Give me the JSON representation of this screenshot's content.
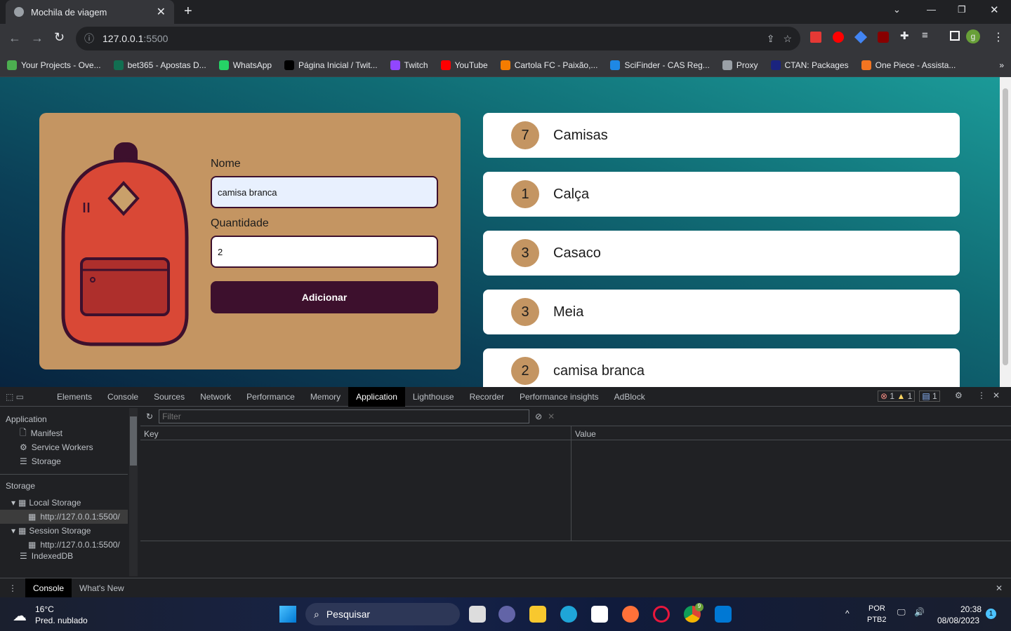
{
  "browser": {
    "tab_title": "Mochila de viagem",
    "url_host": "127.0.0.1",
    "url_port": ":5500",
    "profile_initial": "g",
    "bookmarks": [
      {
        "label": "Your Projects - Ove...",
        "color": "#4caf50"
      },
      {
        "label": "bet365 - Apostas D...",
        "color": "#126e51"
      },
      {
        "label": "WhatsApp",
        "color": "#25d366"
      },
      {
        "label": "Página Inicial / Twit...",
        "color": "#000000"
      },
      {
        "label": "Twitch",
        "color": "#9146ff"
      },
      {
        "label": "YouTube",
        "color": "#ff0000"
      },
      {
        "label": "Cartola FC - Paixão,...",
        "color": "#f57c00"
      },
      {
        "label": "SciFinder - CAS Reg...",
        "color": "#1e88e5"
      },
      {
        "label": "Proxy",
        "color": "#9aa0a6"
      },
      {
        "label": "CTAN: Packages",
        "color": "#1a237e"
      },
      {
        "label": "One Piece - Assista...",
        "color": "#f47521"
      }
    ]
  },
  "form": {
    "name_label": "Nome",
    "name_value": "camisa branca",
    "qty_label": "Quantidade",
    "qty_value": "2",
    "submit_label": "Adicionar"
  },
  "items": [
    {
      "qty": "7",
      "name": "Camisas"
    },
    {
      "qty": "1",
      "name": "Calça"
    },
    {
      "qty": "3",
      "name": "Casaco"
    },
    {
      "qty": "3",
      "name": "Meia"
    },
    {
      "qty": "2",
      "name": "camisa branca"
    }
  ],
  "devtools": {
    "tabs": [
      "Elements",
      "Console",
      "Sources",
      "Network",
      "Performance",
      "Memory",
      "Application",
      "Lighthouse",
      "Recorder",
      "Performance insights",
      "AdBlock"
    ],
    "active_tab": "Application",
    "errors": "1",
    "warnings": "1",
    "messages": "1",
    "filter_placeholder": "Filter",
    "col_key": "Key",
    "col_value": "Value",
    "sidebar": {
      "app_heading": "Application",
      "app_items": [
        "Manifest",
        "Service Workers",
        "Storage"
      ],
      "storage_heading": "Storage",
      "local_storage": "Local Storage",
      "local_origin": "http://127.0.0.1:5500/",
      "session_storage": "Session Storage",
      "session_origin": "http://127.0.0.1:5500/",
      "indexeddb": "IndexedDB"
    },
    "drawer_tabs": [
      "Console",
      "What's New"
    ]
  },
  "taskbar": {
    "temp": "16°C",
    "weather": "Pred. nublado",
    "search": "Pesquisar",
    "lang1": "POR",
    "lang2": "PTB2",
    "time": "20:38",
    "date": "08/08/2023",
    "notif": "1",
    "chrome_badge": "9"
  }
}
